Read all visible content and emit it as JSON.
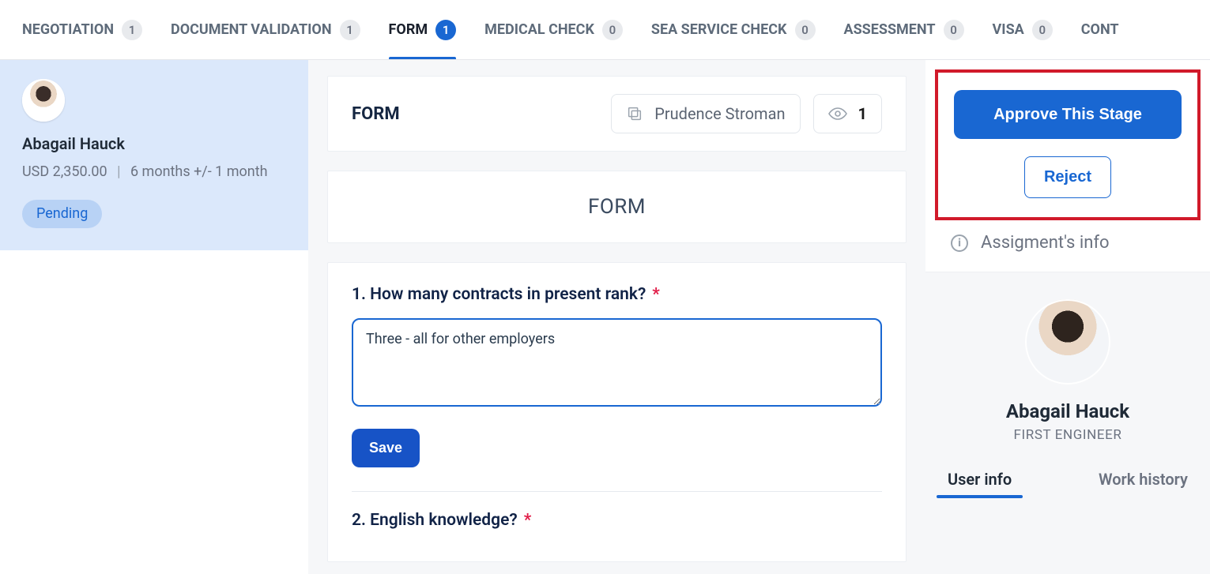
{
  "tabs": [
    {
      "label": "NEGOTIATION",
      "count": "1",
      "active": false
    },
    {
      "label": "DOCUMENT VALIDATION",
      "count": "1",
      "active": false
    },
    {
      "label": "FORM",
      "count": "1",
      "active": true
    },
    {
      "label": "MEDICAL CHECK",
      "count": "0",
      "active": false
    },
    {
      "label": "SEA SERVICE CHECK",
      "count": "0",
      "active": false
    },
    {
      "label": "ASSESSMENT",
      "count": "0",
      "active": false
    },
    {
      "label": "VISA",
      "count": "0",
      "active": false
    },
    {
      "label": "CONT",
      "count": "",
      "active": false
    }
  ],
  "sidebar": {
    "name": "Abagail Hauck",
    "salary": "USD 2,350.00",
    "duration": "6 months +/- 1 month",
    "status": "Pending"
  },
  "header": {
    "title": "FORM",
    "assigned_to": "Prudence Stroman",
    "views": "1"
  },
  "section_title": "FORM",
  "form": {
    "q1_label": "1. How many contracts in present rank?",
    "q1_value": "Three - all for other employers",
    "save_label": "Save",
    "q2_label": "2. English knowledge?"
  },
  "right": {
    "approve_label": "Approve This Stage",
    "reject_label": "Reject",
    "assignment_label": "Assigment's info",
    "profile_name": "Abagail Hauck",
    "profile_role": "FIRST ENGINEER",
    "tabs": [
      {
        "label": "User info",
        "active": true
      },
      {
        "label": "Work history",
        "active": false
      }
    ]
  }
}
